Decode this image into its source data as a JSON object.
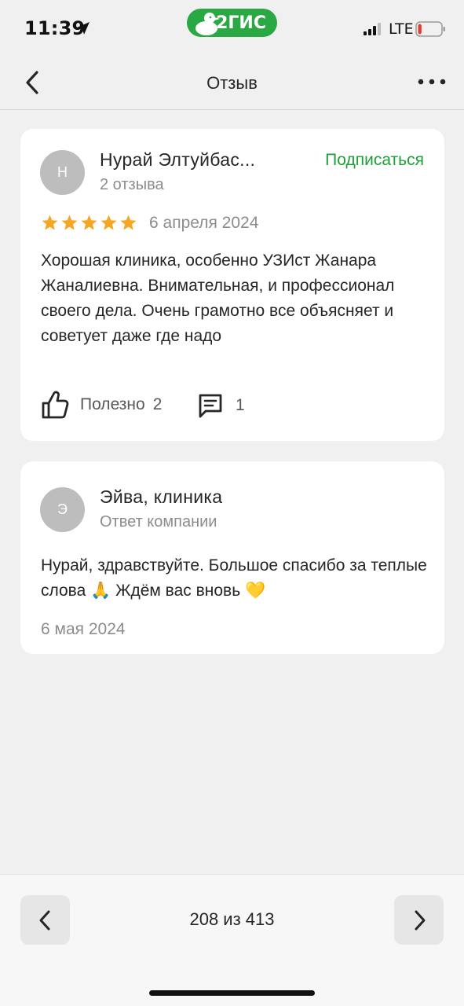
{
  "status_bar": {
    "time": "11:39",
    "network": "LTE",
    "brand": "2ГИС",
    "battery_level": 0.15,
    "battery_color": "#e53935",
    "brand_color": "#29a843"
  },
  "nav": {
    "title": "Отзыв",
    "back_icon": "chevron-left-icon",
    "more_icon": "more-dots-icon"
  },
  "review": {
    "avatar_letter": "Н",
    "author": "Нурай Элтуйбас...",
    "reviews_count": "2 отзыва",
    "subscribe_label": "Подписаться",
    "rating": 5,
    "date": "6 апреля 2024",
    "text": "Хорошая клиника, особенно УЗИст Жанара Жаналиевна. Внимательная, и профессионал своего дела. Очень грамотно все объясняет и советует даже где надо",
    "helpful_label": "Полезно",
    "helpful_count": "2",
    "comments_count": "1"
  },
  "reply": {
    "avatar_letter": "Э",
    "company": "Эйва, клиника",
    "subtitle": "Ответ компании",
    "text": "Нурай, здравствуйте. Большое спасибо за теплые слова 🙏 Ждём вас вновь 💛",
    "date": "6 мая 2024"
  },
  "pager": {
    "text": "208 из 413"
  },
  "colors": {
    "accent_green": "#1ba136",
    "star": "#f5a623",
    "background": "#f0f0f0"
  }
}
